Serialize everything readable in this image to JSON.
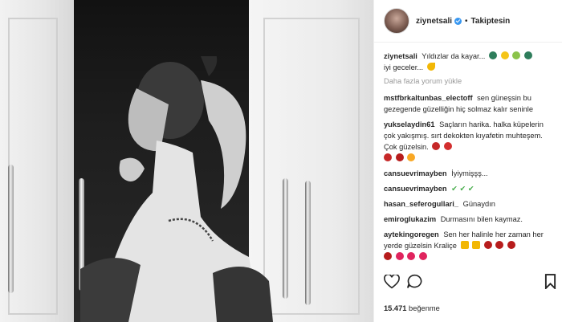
{
  "post": {
    "username": "ziynetsali",
    "follow_label": "Takiptesin",
    "separator": "•"
  },
  "caption": {
    "username": "ziynetsali",
    "text": "Yıldızlar da kayar... ",
    "text2": "iyi geceler... "
  },
  "load_more": "Daha fazla yorum yükle",
  "comments": [
    {
      "username": "mstfbrkaltunbas_electoff",
      "text": "sen güneşsin bu gezegende güzelliğin hiç solmaz kalır seninle"
    },
    {
      "username": "yukselaydin61",
      "text": "Saçların harika. halka küpelerin çok yakışmış. sırt dekokten kıyafetin muhteşem. Çok güzelsin."
    },
    {
      "username": "cansuevrimayben",
      "text": "İyiymişşş..."
    },
    {
      "username": "cansuevrimayben",
      "text": "✔ ✔ ✔"
    },
    {
      "username": "hasan_seferogullari_",
      "text": "Günaydın"
    },
    {
      "username": "emiroglukazim",
      "text": "Durmasını bilen kaymaz."
    },
    {
      "username": "aytekingoregen",
      "text": "Sen her halinle her zaman her yerde güzelsin Kraliçe"
    }
  ],
  "likes": {
    "count": "15.471",
    "label": "beğenme"
  },
  "icons": {
    "like": "heart-outline-icon",
    "comment": "speech-bubble-icon",
    "bookmark": "bookmark-icon",
    "verified": "verified-badge-icon"
  },
  "colors": {
    "verified_blue": "#3897f0",
    "check_green": "#4caf50",
    "emoji_red": "#e0245e",
    "muted_text": "#999999"
  }
}
